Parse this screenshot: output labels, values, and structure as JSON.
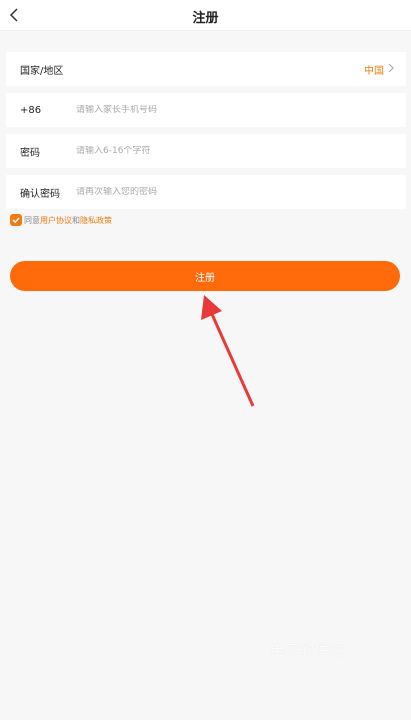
{
  "header": {
    "title": "注册"
  },
  "form": {
    "region": {
      "label": "国家/地区",
      "value": "中国"
    },
    "phone": {
      "code": "+86",
      "placeholder": "请输入家长手机号码"
    },
    "password": {
      "label": "密码",
      "placeholder": "请输入6-16个字符"
    },
    "confirm_password": {
      "label": "确认密码",
      "placeholder": "请再次输入您的密码"
    }
  },
  "agreement": {
    "checked": true,
    "prefix": "同意",
    "user_agreement": "用户协议",
    "and": "和",
    "privacy_policy": "隐私政策"
  },
  "register_button": {
    "label": "注册"
  },
  "watermark": {
    "text": "电子软件站"
  },
  "colors": {
    "accent": "#ff6a0a",
    "link": "#f07a14",
    "arrow": "#e83a3a"
  },
  "icons": [
    "back-icon",
    "chevron-right-icon",
    "checkbox-check-icon",
    "arrow-annotation-icon"
  ]
}
